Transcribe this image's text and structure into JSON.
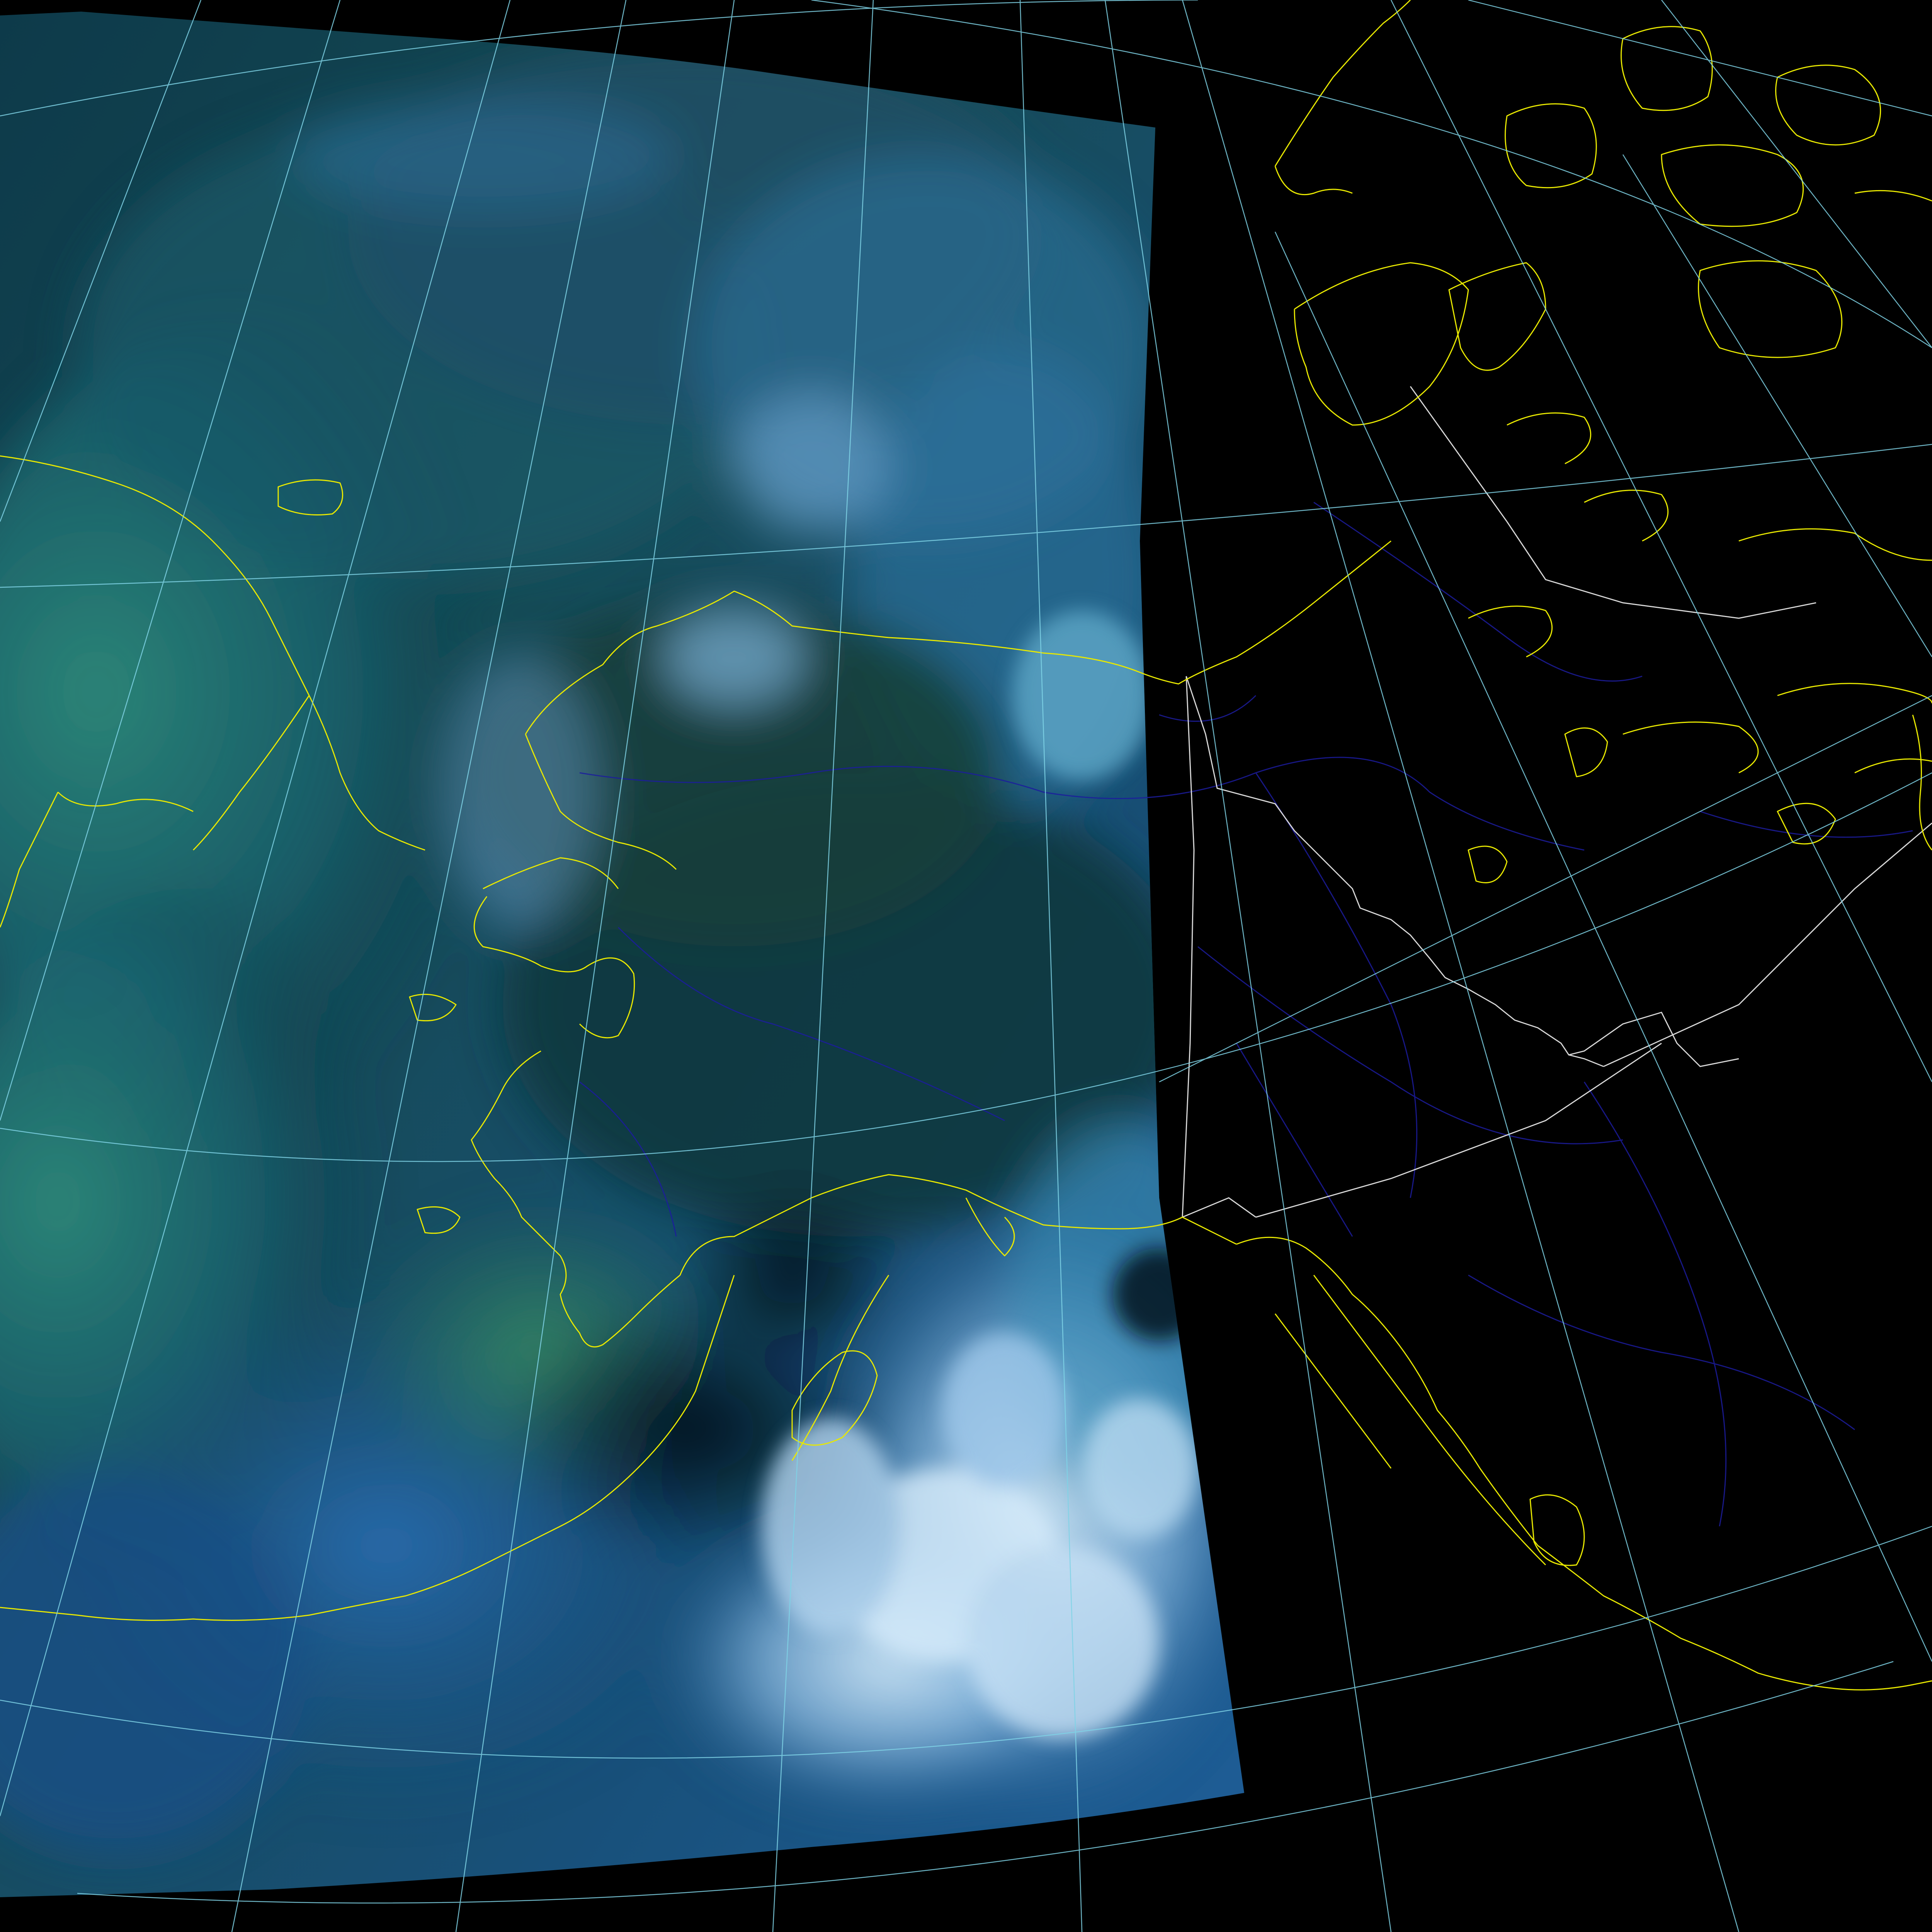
{
  "image": {
    "kind": "satellite composite over Alaska, Yukon and British Columbia with graticule and coastline overlays",
    "visible_text": []
  },
  "colors": {
    "background": "#000000",
    "swath_dark": "#06283a",
    "swath_teal": "#1d6c73",
    "swath_green": "#2a7a5a",
    "swath_blue": "#1f5f9a",
    "cloud_light": "#9fc8ea",
    "cloud_white": "#d6ebfa",
    "land_dark": "#15404a",
    "coastline": "#e8e800",
    "rivers": "#1c1c9e",
    "graticule": "#7fd3e6",
    "borders": "#d8d8d8"
  },
  "layers": {
    "satellite_swath": "satellite-swath",
    "coastlines": "coastline-overlay",
    "rivers": "river-overlay",
    "political_borders": "border-overlay",
    "graticule": "graticule-overlay"
  }
}
